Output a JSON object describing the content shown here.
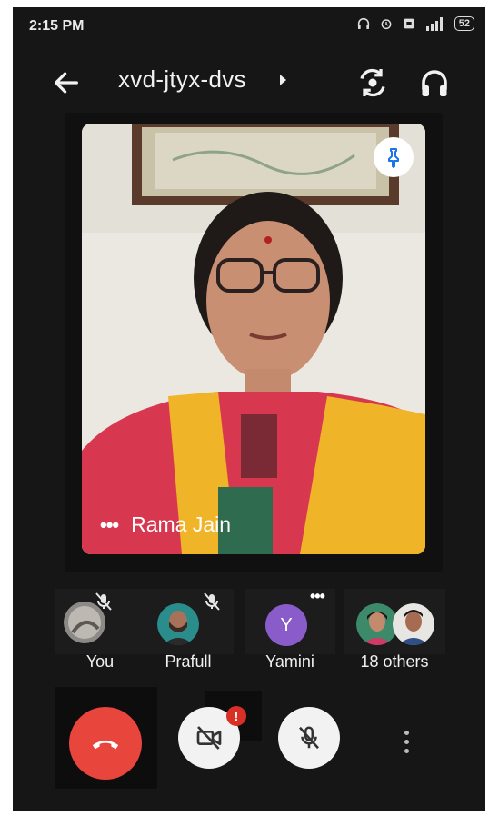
{
  "status_bar": {
    "time": "2:15 PM",
    "battery": "52",
    "icons": [
      "headphones-icon",
      "alarm-icon",
      "sim-icon",
      "signal-icon",
      "battery-icon"
    ]
  },
  "header": {
    "meeting_code": "xvd-jtyx-dvs",
    "icons": [
      "back-arrow-icon",
      "caret-right-icon",
      "switch-camera-icon",
      "headphones-icon"
    ]
  },
  "main_video": {
    "speaker_name": "Rama Jain",
    "options_glyph": "•••",
    "pinned": true
  },
  "participants": [
    {
      "label": "You",
      "muted": true
    },
    {
      "label": "Prafull",
      "muted": true
    },
    {
      "label": "Yamini",
      "initial": "Y",
      "avatar_color": "#8a5cc9",
      "menu_glyph": "•••"
    },
    {
      "label": "18 others"
    }
  ],
  "controls": {
    "camera_alert": "!",
    "end_call_color": "#e8453c",
    "icons": [
      "end-call-icon",
      "camera-off-icon",
      "mic-off-icon",
      "more-vert-icon"
    ]
  }
}
